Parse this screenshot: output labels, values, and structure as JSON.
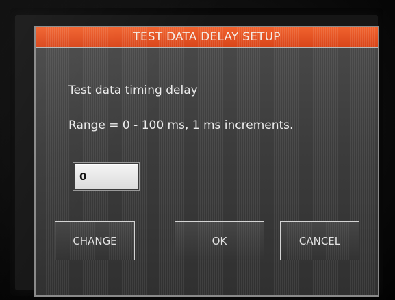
{
  "dialog": {
    "title": "TEST DATA DELAY SETUP",
    "description": "Test data timing delay",
    "range_text": "Range = 0 - 100 ms, 1 ms increments.",
    "value": "0",
    "buttons": {
      "change": "CHANGE",
      "ok": "OK",
      "cancel": "CANCEL"
    }
  },
  "colors": {
    "title_bar": "#e8501f",
    "dialog_background": "#3e3e3e",
    "text": "#ececec",
    "button_border": "#d4d4d4"
  }
}
